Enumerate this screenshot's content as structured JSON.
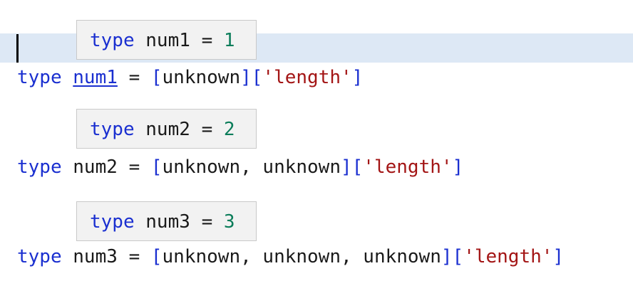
{
  "editor": {
    "hints": [
      {
        "keyword": "type",
        "name": "num1",
        "eq": "=",
        "value": "1"
      },
      {
        "keyword": "type",
        "name": "num2",
        "eq": "=",
        "value": "2"
      },
      {
        "keyword": "type",
        "name": "num3",
        "eq": "=",
        "value": "3"
      }
    ],
    "lines": [
      {
        "keyword": "type",
        "name": "num1",
        "eq": "=",
        "open": "[",
        "elements": "unknown",
        "close": "]",
        "index_open": "[",
        "index": "'length'",
        "index_close": "]"
      },
      {
        "keyword": "type",
        "name": "num2",
        "eq": "=",
        "open": "[",
        "elements": "unknown, unknown",
        "close": "]",
        "index_open": "[",
        "index": "'length'",
        "index_close": "]"
      },
      {
        "keyword": "type",
        "name": "num3",
        "eq": "=",
        "open": "[",
        "elements": "unknown, unknown, unknown",
        "close": "]",
        "index_open": "[",
        "index": "'length'",
        "index_close": "]"
      }
    ]
  },
  "colors": {
    "keyword": "#1a2fd0",
    "string": "#a31515",
    "number": "#0b7d5a",
    "current_line": "#dde8f5",
    "hint_background": "#f2f2f2"
  }
}
